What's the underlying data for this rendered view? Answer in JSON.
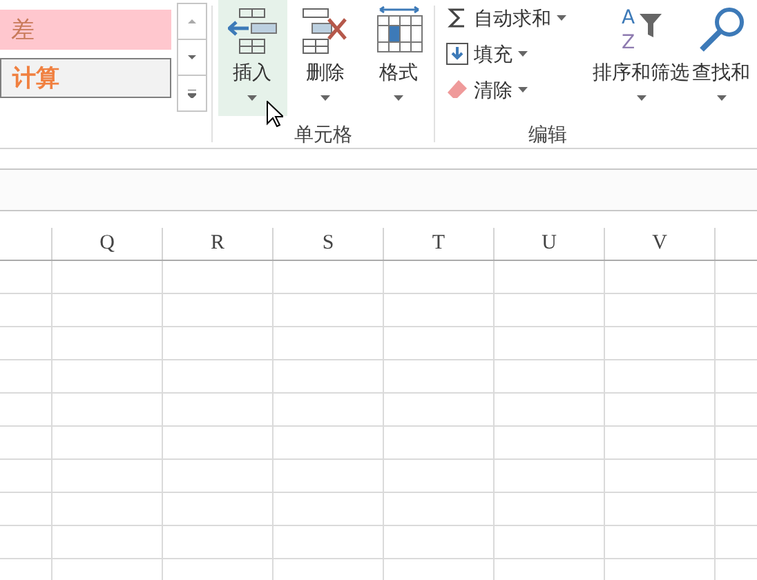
{
  "styles_gallery": {
    "items": [
      {
        "label": "差",
        "kind": "bad"
      },
      {
        "label": "计算",
        "kind": "calc"
      }
    ]
  },
  "cells_group": {
    "label": "单元格",
    "buttons": [
      {
        "label": "插入",
        "selected": true
      },
      {
        "label": "删除",
        "selected": false
      },
      {
        "label": "格式",
        "selected": false
      }
    ]
  },
  "editing_group": {
    "label": "编辑",
    "small_buttons": [
      {
        "label": "自动求和"
      },
      {
        "label": "填充"
      },
      {
        "label": "清除"
      }
    ],
    "large_buttons": [
      {
        "label": "排序和筛选",
        "icon_letters": [
          "A",
          "Z"
        ]
      },
      {
        "label": "查找和"
      }
    ]
  },
  "sheet": {
    "columns": [
      "Q",
      "R",
      "S",
      "T",
      "U",
      "V"
    ]
  }
}
